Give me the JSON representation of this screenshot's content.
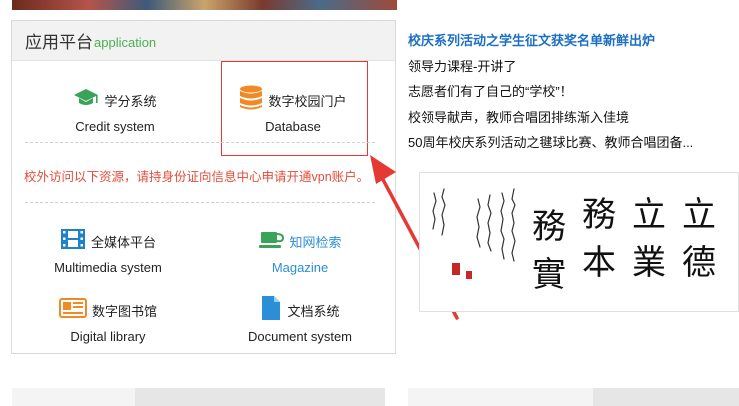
{
  "app_panel": {
    "title": "应用平台",
    "subtitle": "application",
    "vpn_notice": "校外访问以下资源，请持身份证向信息中心申请开通vpn账户。",
    "tiles": [
      {
        "cn": "学分系统",
        "en": "Credit system",
        "icon": "graduation-cap-icon"
      },
      {
        "cn": "数字校园门户",
        "en": "Database",
        "icon": "database-icon"
      },
      {
        "cn": "全媒体平台",
        "en": "Multimedia system",
        "icon": "film-icon"
      },
      {
        "cn": "知网检索",
        "en": "Magazine",
        "icon": "cup-icon"
      },
      {
        "cn": "数字图书馆",
        "en": "Digital library",
        "icon": "newspaper-icon"
      },
      {
        "cn": "文档系统",
        "en": "Document system",
        "icon": "document-icon"
      }
    ]
  },
  "news": {
    "items": [
      "校庆系列活动之学生征文获奖名单新鲜出炉",
      "领导力课程-开讲了",
      "志愿者们有了自己的“学校”！",
      "校领导献声，教师合唱团排练渐入佳境",
      "50周年校庆系列活动之毽球比赛、教师合唱团备..."
    ]
  },
  "calligraphy": {
    "main_chars": [
      "立",
      "德",
      "立",
      "業",
      "務",
      "本",
      "務",
      "實"
    ]
  },
  "colors": {
    "accent_green": "#4caf50",
    "link_blue": "#1c6fc4",
    "notice_red": "#e24e3a",
    "annotation_red": "#e53935",
    "icon_orange": "#f08a24",
    "icon_blue": "#2a8fd6"
  }
}
